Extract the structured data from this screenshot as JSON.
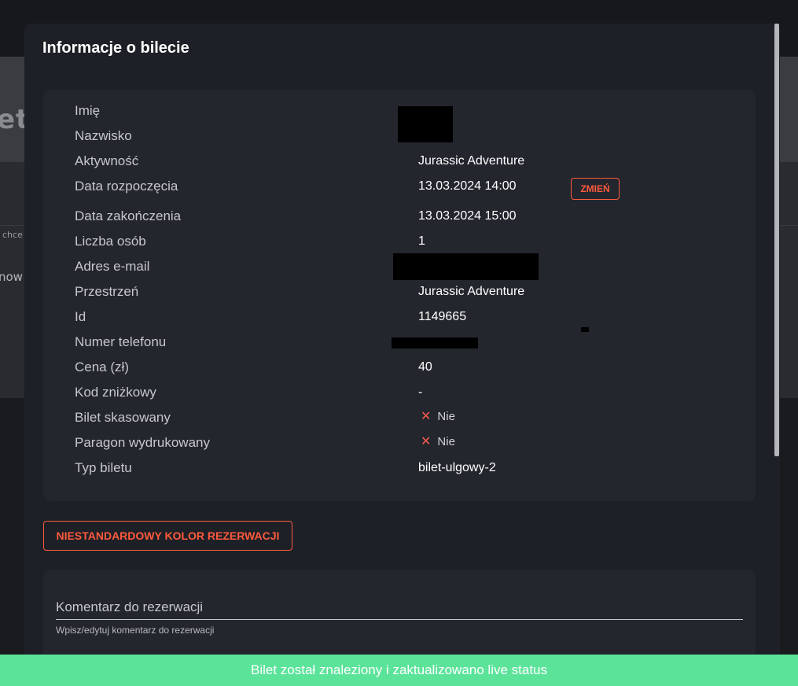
{
  "background": {
    "title_fragment": "et",
    "small_fragment": "chce",
    "word_fragment": "now"
  },
  "modal": {
    "title": "Informacje o bilecie",
    "labels": {
      "first_name": "Imię",
      "last_name": "Nazwisko",
      "activity": "Aktywność",
      "start_date": "Data rozpoczęcia",
      "end_date": "Data zakończenia",
      "people_count": "Liczba osób",
      "email": "Adres e-mail",
      "space": "Przestrzeń",
      "id": "Id",
      "phone": "Numer telefonu",
      "price": "Cena (zł)",
      "discount_code": "Kod zniżkowy",
      "ticket_cancelled": "Bilet skasowany",
      "receipt_printed": "Paragon wydrukowany",
      "ticket_type": "Typ biletu"
    },
    "values": {
      "activity": "Jurassic Adventure",
      "start_date": "13.03.2024 14:00",
      "end_date": "13.03.2024 15:00",
      "people_count": "1",
      "space": "Jurassic Adventure",
      "id": "1149665",
      "price": "40",
      "discount_code": "-",
      "ticket_cancelled": "Nie",
      "receipt_printed": "Nie",
      "ticket_type": "bilet-ulgowy-2"
    },
    "change_button": "ZMIEŃ",
    "custom_color_button": "NIESTANDARDOWY KOLOR REZERWACJI",
    "comment": {
      "label": "Komentarz do rezerwacji",
      "hint": "Wpisz/edytuj komentarz do rezerwacji"
    }
  },
  "toast": "Bilet został znaleziony i zaktualizowano live status",
  "colors": {
    "accent": "#ff5a3d",
    "toast": "#5ce39a",
    "modal_bg": "#1d2026",
    "card_bg": "#23262d"
  },
  "icons": {
    "status_false": "close-x-icon"
  }
}
